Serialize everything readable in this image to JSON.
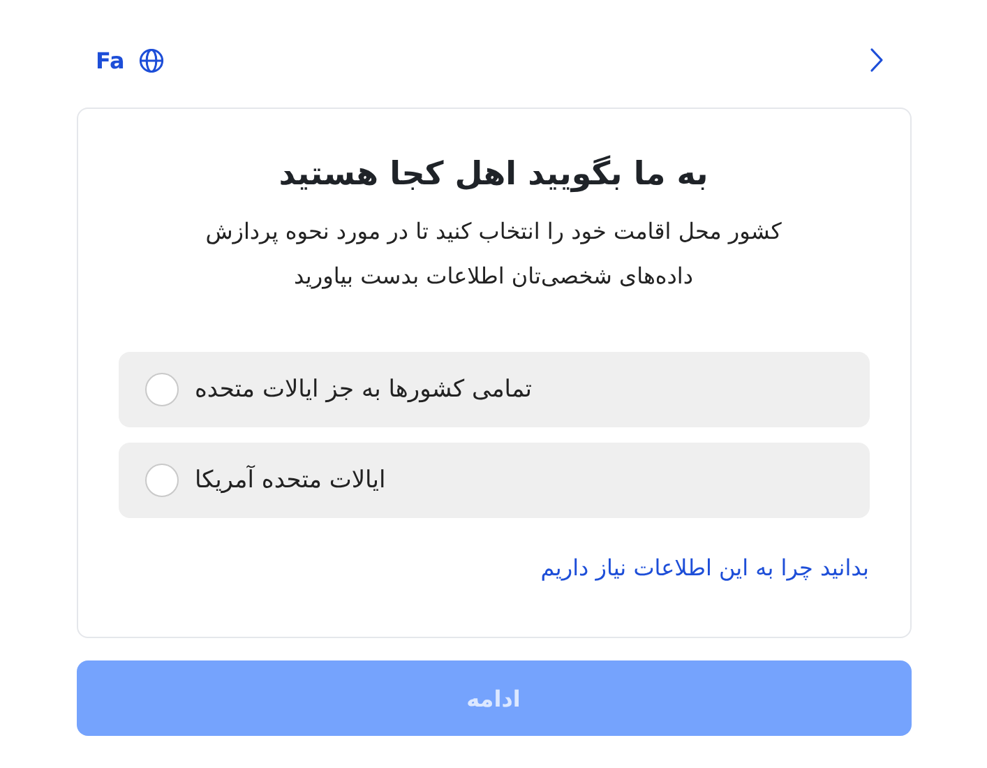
{
  "header": {
    "language": "Fa"
  },
  "card": {
    "title": "به ما بگویید اهل کجا هستید",
    "subtitle": "کشور محل اقامت خود را انتخاب کنید تا در مورد نحوه پردازش داده‌های شخصی‌تان اطلاعات بدست بیاورید",
    "options": [
      {
        "label": "تمامی کشورها به جز ایالات متحده",
        "selected": false
      },
      {
        "label": "ایالات متحده آمریکا",
        "selected": false
      }
    ],
    "link": "بدانید چرا به این اطلاعات نیاز داریم"
  },
  "continue_button": {
    "label": "ادامه",
    "disabled": true
  }
}
